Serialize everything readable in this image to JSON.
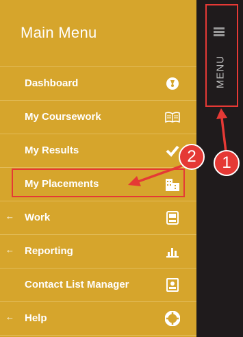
{
  "menu": {
    "title": "Main Menu",
    "items": [
      {
        "label": "Dashboard",
        "has_arrow": false,
        "icon": "gauge-icon"
      },
      {
        "label": "My Coursework",
        "has_arrow": false,
        "icon": "book-icon"
      },
      {
        "label": "My Results",
        "has_arrow": false,
        "icon": "checkmark-icon"
      },
      {
        "label": "My Placements",
        "has_arrow": false,
        "icon": "building-icon"
      },
      {
        "label": "Work",
        "has_arrow": true,
        "icon": "inbox-icon"
      },
      {
        "label": "Reporting",
        "has_arrow": true,
        "icon": "bar-chart-icon"
      },
      {
        "label": "Contact List Manager",
        "has_arrow": false,
        "icon": "contact-card-icon"
      },
      {
        "label": "Help",
        "has_arrow": true,
        "icon": "lifebuoy-icon"
      }
    ]
  },
  "side_toggle": {
    "label": "MENU",
    "icon": "hamburger-icon"
  },
  "annotations": {
    "callout_1": "1",
    "callout_2": "2"
  },
  "arrow_glyph": "←",
  "colors": {
    "menu_bg": "#d6a52c",
    "side_bar_bg": "#1f1b1c",
    "annotation_red": "#e53935"
  }
}
